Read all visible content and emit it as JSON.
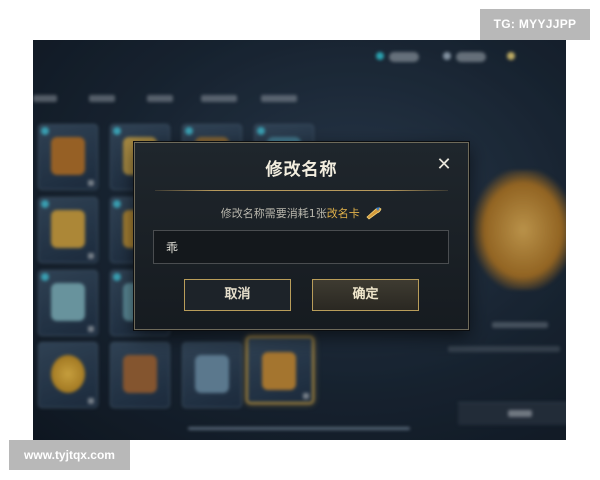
{
  "dialog": {
    "title": "修改名称",
    "close_symbol": "✕",
    "hint_prefix": "修改名称需要消耗1张",
    "hint_item": "改名卡",
    "item_icon": "rename-card-icon",
    "input_value": "乖",
    "cancel_label": "取消",
    "confirm_label": "确定"
  },
  "watermarks": {
    "tg": "TG: MYYJJPP",
    "url": "www.tyjtqx.com"
  },
  "colors": {
    "accent_gold": "#e0b14a",
    "border_gold": "#b99d5a",
    "dialog_bg": "#1b2126",
    "currency_icon": "#36c6d6"
  }
}
